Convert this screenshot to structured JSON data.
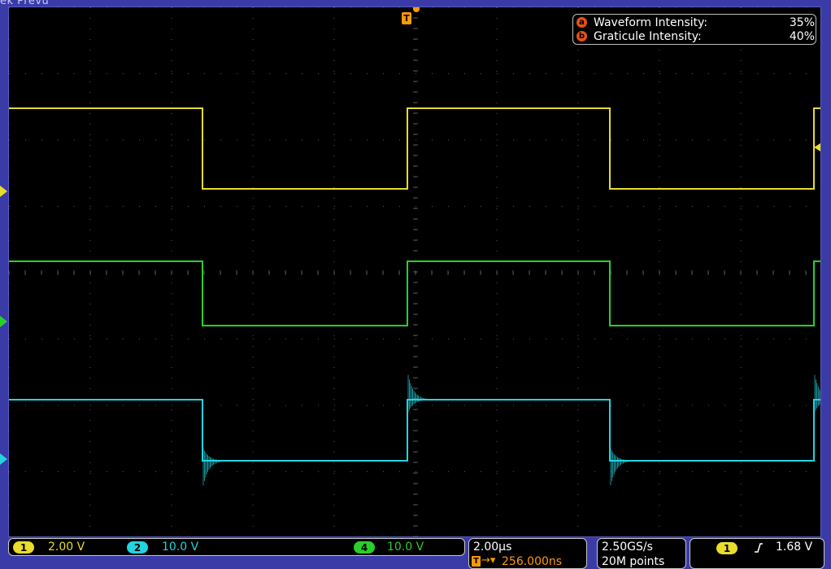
{
  "window": {
    "title": "ek Prevu"
  },
  "colors": {
    "ch1": "#e8dc2c",
    "ch2": "#22d4e0",
    "ch4": "#2ad02a",
    "trigger": "#ff9a00",
    "frame": "#3b3ba8"
  },
  "trigger_marker": {
    "label": "T"
  },
  "intensity_popup": {
    "waveform": {
      "key": "a",
      "label": "Waveform Intensity:",
      "value": "35%"
    },
    "graticule": {
      "key": "b",
      "label": "Graticule Intensity:",
      "value": "40%"
    }
  },
  "channels": [
    {
      "id": "1",
      "scale": "2.00 V"
    },
    {
      "id": "2",
      "scale": "10.0 V"
    },
    {
      "id": "4",
      "scale": "10.0 V"
    }
  ],
  "horizontal": {
    "scale": "2.00µs",
    "position": "256.000ns",
    "trigger_icon": "T"
  },
  "acquisition": {
    "rate": "2.50GS/s",
    "record": "20M points"
  },
  "trigger": {
    "source": "1",
    "slope_icon": "rising-edge-icon",
    "level": "1.68 V"
  }
}
